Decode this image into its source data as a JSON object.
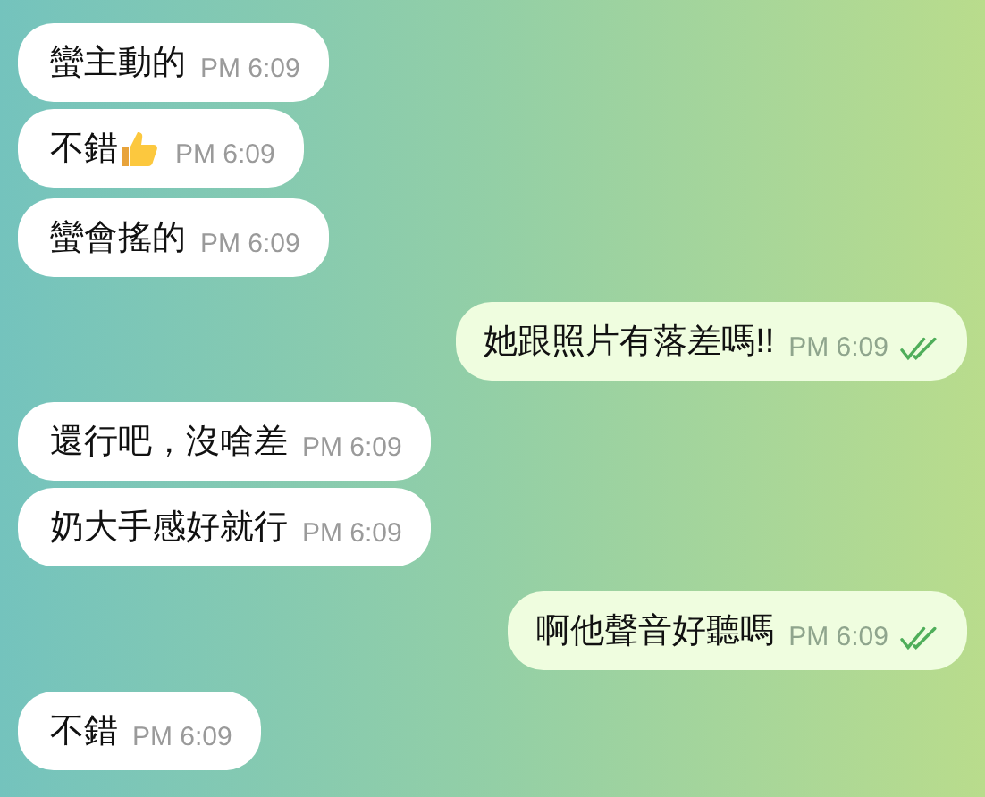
{
  "messages": [
    {
      "kind": "incoming",
      "text": "蠻主動的",
      "time": "PM 6:09"
    },
    {
      "kind": "incoming",
      "text": "不錯",
      "thumbs_up": true,
      "time": "PM 6:09"
    },
    {
      "kind": "incoming",
      "text": "蠻會搖的",
      "time": "PM 6:09"
    },
    {
      "kind": "outgoing",
      "text": "她跟照片有落差嗎!!",
      "time": "PM 6:09",
      "read": true
    },
    {
      "kind": "incoming",
      "text": "還行吧，沒啥差",
      "time": "PM 6:09"
    },
    {
      "kind": "incoming",
      "text": "奶大手感好就行",
      "time": "PM 6:09"
    },
    {
      "kind": "outgoing",
      "text": "啊他聲音好聽嗎",
      "time": "PM 6:09",
      "read": true
    },
    {
      "kind": "incoming",
      "text": "不錯",
      "time": "PM 6:09"
    }
  ]
}
